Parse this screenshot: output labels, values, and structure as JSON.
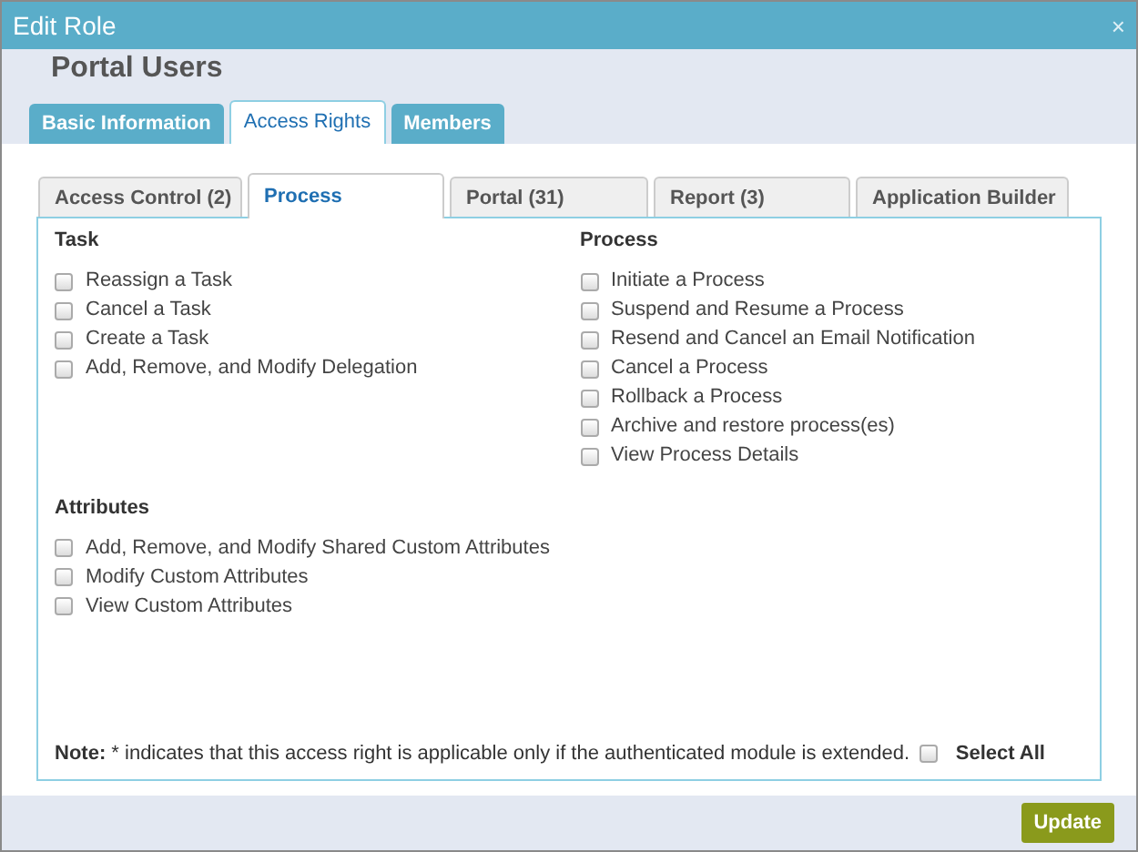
{
  "window": {
    "title": "Edit Role",
    "close": "×"
  },
  "role_name": "Portal Users",
  "main_tabs": [
    {
      "label": "Basic Information",
      "selected": false
    },
    {
      "label": "Access Rights",
      "selected": true
    },
    {
      "label": "Members",
      "selected": false
    }
  ],
  "sub_tabs": [
    {
      "label": "Access Control (2)",
      "selected": false
    },
    {
      "label": "Process",
      "selected": true
    },
    {
      "label": "Portal (31)",
      "selected": false
    },
    {
      "label": "Report (3)",
      "selected": false
    },
    {
      "label": "Application Builder",
      "selected": false
    }
  ],
  "columns": [
    [
      {
        "heading": "Task",
        "items": [
          {
            "label": "Reassign a Task",
            "checked": false
          },
          {
            "label": "Cancel a Task",
            "checked": false
          },
          {
            "label": "Create a Task",
            "checked": false
          },
          {
            "label": "Add, Remove, and Modify Delegation",
            "checked": false
          }
        ]
      },
      {
        "heading": "Attributes",
        "items": [
          {
            "label": "Add, Remove, and Modify Shared Custom Attributes",
            "checked": false
          },
          {
            "label": "Modify Custom Attributes",
            "checked": false
          },
          {
            "label": "View Custom Attributes",
            "checked": false
          }
        ]
      }
    ],
    [
      {
        "heading": "Process",
        "items": [
          {
            "label": "Initiate a Process",
            "checked": false
          },
          {
            "label": "Suspend and Resume a Process",
            "checked": false
          },
          {
            "label": "Resend and Cancel an Email Notification",
            "checked": false
          },
          {
            "label": "Cancel a Process",
            "checked": false
          },
          {
            "label": "Rollback a Process",
            "checked": false
          },
          {
            "label": "Archive and restore process(es)",
            "checked": false
          },
          {
            "label": "View Process Details",
            "checked": false
          }
        ]
      }
    ]
  ],
  "note": "**Note:** * indicates that this access right is applicable only if the authenticated module is extended.",
  "select_all": {
    "label": "Select All",
    "checked": false
  },
  "update_button": "Update"
}
